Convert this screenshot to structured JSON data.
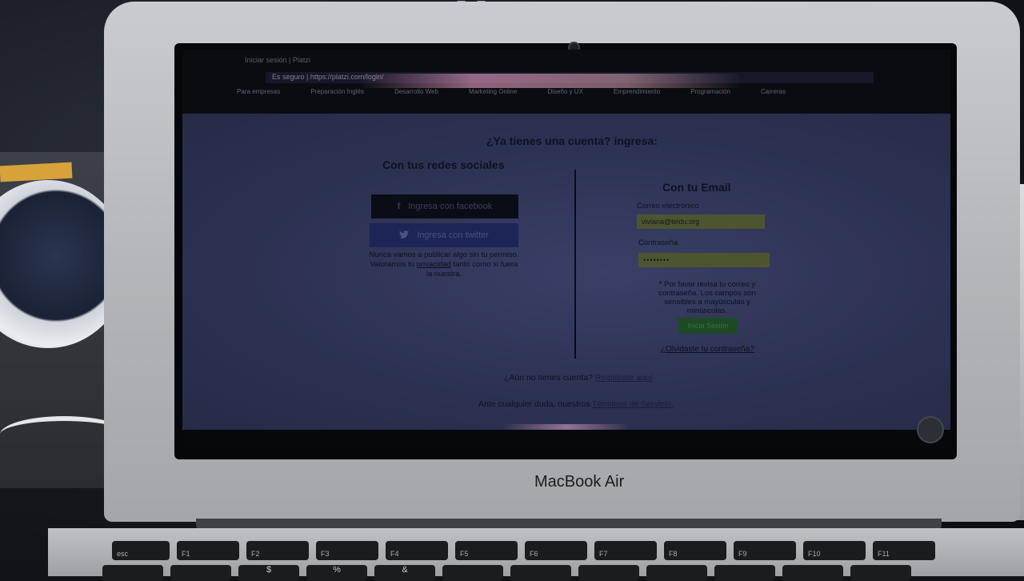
{
  "browser": {
    "tab_title": "Iniciar sesión | Platzi",
    "url": "Es seguro | https://platzi.com/login/",
    "nav_items": [
      "Para empresas",
      "Preparación Inglés",
      "Desarrollo Web",
      "Marketing Online",
      "Diseño y UX",
      "Emprendimiento",
      "Programación",
      "Carreras"
    ]
  },
  "login": {
    "title": "¿Ya tienes una cuenta? ingresa:",
    "social_heading": "Con tus redes sociales",
    "facebook_label": "Ingresa con facebook",
    "twitter_label": "Ingresa con twitter",
    "privacy_note_pre": "Nunca vamos a publicar algo sin tu permiso. Valoramos tu ",
    "privacy_link": "privacidad",
    "privacy_note_post": " tanto como si fuera la nuestra.",
    "email_heading": "Con tu Email",
    "email_label": "Correo electrónico",
    "email_value": "viviana@teidu.org",
    "password_label": "Contraseña",
    "password_value": "••••••••",
    "error_message": "* Por favor revisa tu correo y contraseña. Los campos son sensibles a mayúsculas y minúsculas.",
    "login_button": "Inicia Sesión",
    "forgot_pre": "¿Olvidaste tu ",
    "forgot_link": "contraseña?",
    "signup_text": "¿Aún no tienes cuenta? ",
    "signup_link": "Regístrate aquí",
    "terms_text": "Ante cualquier duda, nuestros ",
    "terms_link": "Términos de Servicio."
  },
  "laptop": {
    "brand": "MacBook Air",
    "fn_keys": [
      "esc",
      "F1",
      "F2",
      "F3",
      "F4",
      "F5",
      "F6",
      "F7",
      "F8",
      "F9",
      "F10",
      "F11",
      "F12"
    ],
    "num_keys": [
      "",
      "",
      "$",
      "%",
      "&",
      "",
      "",
      "",
      "",
      "",
      "",
      "",
      ""
    ]
  },
  "overlay_icons": {
    "pause": "❚❚",
    "forward": "►►",
    "skip": "►|",
    "repeat": "⇄"
  }
}
